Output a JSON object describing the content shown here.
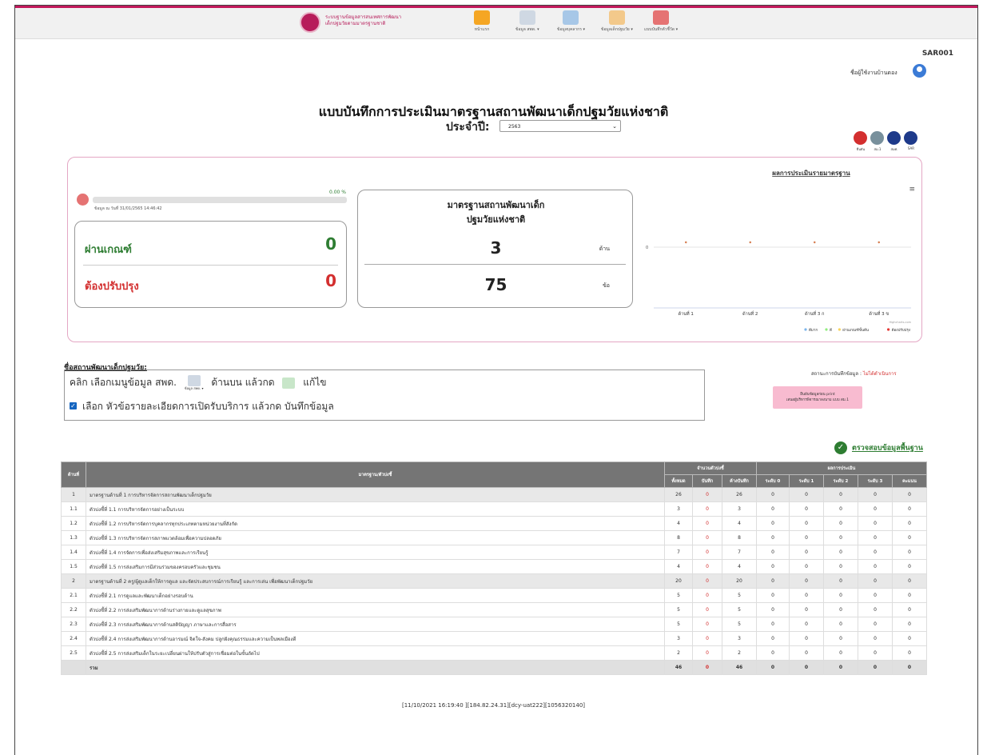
{
  "header": {
    "logo_text_line1": "ระบบฐานข้อมูลสารสนเทศการพัฒนา",
    "logo_text_line2": "เด็กปฐมวัยตามมาตรฐานชาติ",
    "nav": [
      {
        "label": "หน้าแรก",
        "icon": "home-icon",
        "color": "#f5a623"
      },
      {
        "label": "ข้อมูล สพด. ▾",
        "icon": "document-icon",
        "color": "#cfd8e3"
      },
      {
        "label": "ข้อมูลบุคลากร ▾",
        "icon": "search-people-icon",
        "color": "#a7c7e7"
      },
      {
        "label": "ข้อมูลเด็กปฐมวัย ▾",
        "icon": "children-icon",
        "color": "#f3c98b"
      },
      {
        "label": "แบบบันทึกตัวชี้วัด ▾",
        "icon": "record-book-icon",
        "color": "#e57373"
      }
    ]
  },
  "user": {
    "code": "SAR001",
    "name": "ชื่อผู้ใช้งานบ้านดอง"
  },
  "page": {
    "title": "แบบบันทึกการประเมินมาตรฐานสถานพัฒนาเด็กปฐมวัยแห่งชาติ",
    "year_label": "ประจำปี:",
    "year_value": "2563"
  },
  "actions": [
    {
      "label": "ยืนยัน",
      "icon": "lock-icon",
      "color": "#d32f2f"
    },
    {
      "label": "สม.1",
      "icon": "print-icon",
      "color": "#78909c"
    },
    {
      "label": "สมศ.",
      "icon": "print-icon",
      "color": "#1e3a8a"
    },
    {
      "label": "SAR",
      "icon": "print-icon",
      "color": "#1e3a8a"
    }
  ],
  "summary": {
    "progress_pct": "0.00 %",
    "progress_value": 0,
    "data_date": "ข้อมูล ณ วันที่ 31/01/2565 14:46:42",
    "pass_label": "ผ่านเกณฑ์",
    "pass_value": "0",
    "fix_label": "ต้องปรับปรุง",
    "fix_value": "0",
    "std_title_line1": "มาตรฐานสถานพัฒนาเด็ก",
    "std_title_line2": "ปฐมวัยแห่งชาติ",
    "sides_count": "3",
    "sides_unit": "ด้าน",
    "items_count": "75",
    "items_unit": "ข้อ"
  },
  "chart_data": {
    "type": "line",
    "title": "ผลการประเมินรายมาตรฐาน",
    "categories": [
      "ด้านที่ 1",
      "ด้านที่ 2",
      "ด้านที่ 3 ก",
      "ด้านที่ 3 ข"
    ],
    "series": [
      {
        "name": "ดีมาก",
        "color": "#7cb5ec",
        "values": [
          0,
          0,
          0,
          0
        ]
      },
      {
        "name": "ดี",
        "color": "#90ed7d",
        "values": [
          0,
          0,
          0,
          0
        ]
      },
      {
        "name": "ผ่านเกณฑ์ขั้นต้น",
        "color": "#f7d35c",
        "values": [
          0,
          0,
          0,
          0
        ]
      },
      {
        "name": "ต้องปรับปรุง",
        "color": "#e53935",
        "values": [
          0,
          0,
          0,
          0
        ]
      }
    ],
    "y_tick_label": "0",
    "credit": "Highcharts.com",
    "legend_position": "bottom-right"
  },
  "center": {
    "section_title": "ชื่อสถานพัฒนาเด็กปฐมวัย:",
    "instr1_pre": "คลิก เลือกเมนูข้อมูล สพด.",
    "instr1_mid": "ด้านบน แล้วกด",
    "instr1_post": "แก้ไข",
    "instr_icon_caption": "ข้อมูล สพด. ▾",
    "instr2": "เลือก หัวข้อรายละเอียดการเปิดรับบริการ แล้วกด บันทึกข้อมูล",
    "status_label": "สถานะการบันทึกข้อมูล :",
    "status_value": "ไม่ได้ดำเนินการ",
    "print_line1": "ยืนยันข้อมูลก่อน print",
    "print_line2": "เสนอผู้บริหารพิจารณาลงนาม แบบ สม.1",
    "check_label": "ตรวจสอบข้อมูลพื้นฐาน"
  },
  "table": {
    "headers": {
      "side": "ด้านที่",
      "standard": "มาตรฐาน/ตัวบ่งชี้",
      "count_group": "จำนวนตัวบ่งชี้",
      "result_group": "ผลการประเมิน",
      "all": "ทั้งหมด",
      "saved": "บันทึก",
      "pending": "ค้างบันทึก",
      "l0": "ระดับ 0",
      "l1": "ระดับ 1",
      "l2": "ระดับ 2",
      "l3": "ระดับ 3",
      "score": "คะแนน"
    },
    "rows": [
      {
        "no": "1",
        "name": "มาตรฐานด้านที่ 1 การบริหารจัดการสถานพัฒนาเด็กปฐมวัย",
        "all": "26",
        "saved": "0",
        "pending": "26",
        "l0": "0",
        "l1": "0",
        "l2": "0",
        "l3": "0",
        "score": "0",
        "group": true
      },
      {
        "no": "1.1",
        "name": "ตัวบ่งชี้ที่ 1.1 การบริหารจัดการอย่างเป็นระบบ",
        "all": "3",
        "saved": "0",
        "pending": "3",
        "l0": "0",
        "l1": "0",
        "l2": "0",
        "l3": "0",
        "score": "0",
        "group": false
      },
      {
        "no": "1.2",
        "name": "ตัวบ่งชี้ที่ 1.2 การบริหารจัดการบุคลากรทุกประเภทตามหน่วยงานที่สังกัด",
        "all": "4",
        "saved": "0",
        "pending": "4",
        "l0": "0",
        "l1": "0",
        "l2": "0",
        "l3": "0",
        "score": "0",
        "group": false
      },
      {
        "no": "1.3",
        "name": "ตัวบ่งชี้ที่ 1.3 การบริหารจัดการสภาพแวดล้อมเพื่อความปลอดภัย",
        "all": "8",
        "saved": "0",
        "pending": "8",
        "l0": "0",
        "l1": "0",
        "l2": "0",
        "l3": "0",
        "score": "0",
        "group": false
      },
      {
        "no": "1.4",
        "name": "ตัวบ่งชี้ที่ 1.4 การจัดการเพื่อส่งเสริมสุขภาพและการเรียนรู้",
        "all": "7",
        "saved": "0",
        "pending": "7",
        "l0": "0",
        "l1": "0",
        "l2": "0",
        "l3": "0",
        "score": "0",
        "group": false
      },
      {
        "no": "1.5",
        "name": "ตัวบ่งชี้ที่ 1.5 การส่งเสริมการมีส่วนร่วมของครอบครัวและชุมชน",
        "all": "4",
        "saved": "0",
        "pending": "4",
        "l0": "0",
        "l1": "0",
        "l2": "0",
        "l3": "0",
        "score": "0",
        "group": false
      },
      {
        "no": "2",
        "name": "มาตรฐานด้านที่ 2 ครู/ผู้ดูแลเด็กให้การดูแล และจัดประสบการณ์การเรียนรู้ และการเล่น เพื่อพัฒนาเด็กปฐมวัย",
        "all": "20",
        "saved": "0",
        "pending": "20",
        "l0": "0",
        "l1": "0",
        "l2": "0",
        "l3": "0",
        "score": "0",
        "group": true
      },
      {
        "no": "2.1",
        "name": "ตัวบ่งชี้ที่ 2.1 การดูแลและพัฒนาเด็กอย่างรอบด้าน",
        "all": "5",
        "saved": "0",
        "pending": "5",
        "l0": "0",
        "l1": "0",
        "l2": "0",
        "l3": "0",
        "score": "0",
        "group": false
      },
      {
        "no": "2.2",
        "name": "ตัวบ่งชี้ที่ 2.2 การส่งเสริมพัฒนาการด้านร่างกายและดูแลสุขภาพ",
        "all": "5",
        "saved": "0",
        "pending": "5",
        "l0": "0",
        "l1": "0",
        "l2": "0",
        "l3": "0",
        "score": "0",
        "group": false
      },
      {
        "no": "2.3",
        "name": "ตัวบ่งชี้ที่ 2.3 การส่งเสริมพัฒนาการด้านสติปัญญา ภาษาและการสื่อสาร",
        "all": "5",
        "saved": "0",
        "pending": "5",
        "l0": "0",
        "l1": "0",
        "l2": "0",
        "l3": "0",
        "score": "0",
        "group": false
      },
      {
        "no": "2.4",
        "name": "ตัวบ่งชี้ที่ 2.4 การส่งเสริมพัฒนาการด้านอารมณ์ จิตใจ-สังคม ปลูกฝังคุณธรรมและความเป็นพลเมืองดี",
        "all": "3",
        "saved": "0",
        "pending": "3",
        "l0": "0",
        "l1": "0",
        "l2": "0",
        "l3": "0",
        "score": "0",
        "group": false
      },
      {
        "no": "2.5",
        "name": "ตัวบ่งชี้ที่ 2.5 การส่งเสริมเด็กในระยะเปลี่ยนผ่านให้ปรับตัวสู่การเชื่อมต่อในขั้นถัดไป",
        "all": "2",
        "saved": "0",
        "pending": "2",
        "l0": "0",
        "l1": "0",
        "l2": "0",
        "l3": "0",
        "score": "0",
        "group": false
      }
    ],
    "total": {
      "label": "รวม",
      "all": "46",
      "saved": "0",
      "pending": "46",
      "l0": "0",
      "l1": "0",
      "l2": "0",
      "l3": "0",
      "score": "0"
    }
  },
  "footer": "[11/10/2021 16:19:40 ][184.82.24.31][dcy-uat222][1056320140]"
}
